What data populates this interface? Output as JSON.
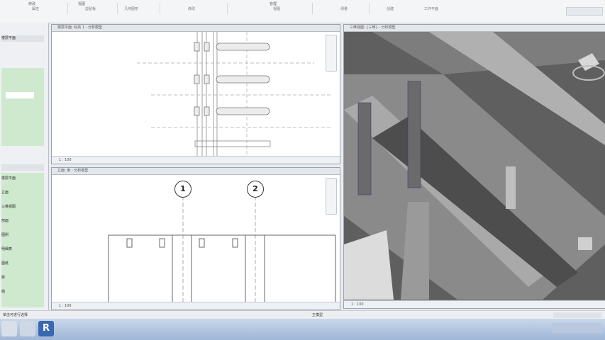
{
  "ribbon": {
    "tabs": [
      "修改",
      "视图",
      "管理"
    ],
    "groups": [
      "属性",
      "剪贴板",
      "几何图形",
      "修改",
      "视图",
      "测量",
      "创建",
      "工作平面"
    ]
  },
  "left_panel": {
    "title": "楼层平面",
    "rows": [
      "楼层平面",
      "立面",
      "三维视图",
      "剖面",
      "图例",
      "明细表",
      "图纸",
      "族",
      "组"
    ]
  },
  "views": {
    "plan": {
      "title": "楼层平面: 标高 1 - 分析模型"
    },
    "elevation": {
      "title": "立面: 南 - 分析模型"
    },
    "three_d": {
      "title": "三维视图: {三维} - 分析模型"
    }
  },
  "grid_markers": [
    "1",
    "2"
  ],
  "view_control_bar": {
    "scale": "1 : 100"
  },
  "status": {
    "text": "单击可进行选择",
    "model": "主模型"
  },
  "colors": {
    "ribbon_bg": "#f4f5f7",
    "view_bg": "#ffffff",
    "shaded_gray": "#7a7a7a",
    "taskbar": "#9fb6d6"
  }
}
